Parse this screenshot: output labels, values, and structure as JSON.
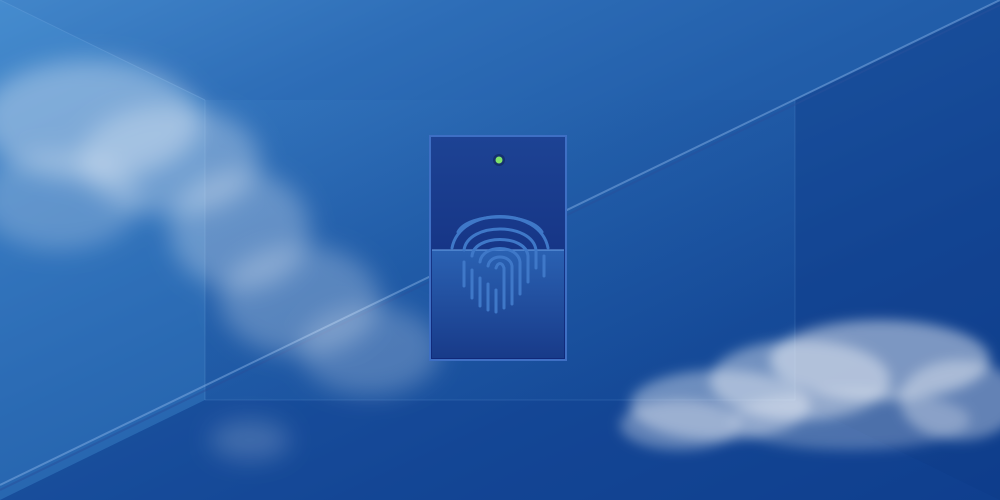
{
  "colors": {
    "sky_light": "#4a8fd0",
    "sky_dark": "#0f3f8e",
    "panel_top": "#1d3f8f",
    "panel_bottom": "#102a72",
    "indicator": "#7fe36a",
    "fingerprint": "#3f78c8",
    "scan_band": "#2a61b0"
  },
  "icons": {
    "scanner": "fingerprint-scanner-icon",
    "indicator": "status-led-icon",
    "fingerprint": "fingerprint-icon"
  }
}
